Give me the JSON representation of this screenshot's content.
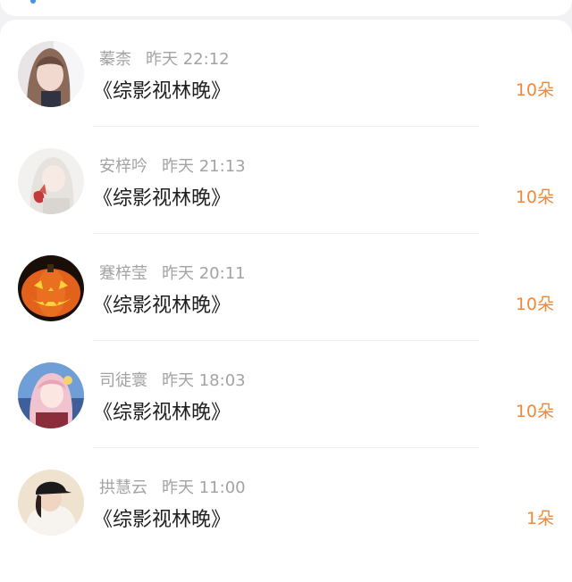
{
  "rewards": [
    {
      "name": "蓁柰",
      "time": "昨天 22:12",
      "book": "《综影视林晚》",
      "amount": "10朵",
      "avatar": "girl-portrait-light"
    },
    {
      "name": "安梓吟",
      "time": "昨天 21:13",
      "book": "《综影视林晚》",
      "amount": "10朵",
      "avatar": "girl-white-hair"
    },
    {
      "name": "蹇梓莹",
      "time": "昨天 20:11",
      "book": "《综影视林晚》",
      "amount": "10朵",
      "avatar": "pumpkin"
    },
    {
      "name": "司徒寰",
      "time": "昨天 18:03",
      "book": "《综影视林晚》",
      "amount": "10朵",
      "avatar": "anime-pink-hair"
    },
    {
      "name": "拱慧云",
      "time": "昨天 11:00",
      "book": "《综影视林晚》",
      "amount": "1朵",
      "avatar": "girl-black-cap"
    }
  ],
  "colors": {
    "amount": "#f08a3a",
    "meta": "#a3a3a3",
    "title": "#1f1f1f"
  }
}
